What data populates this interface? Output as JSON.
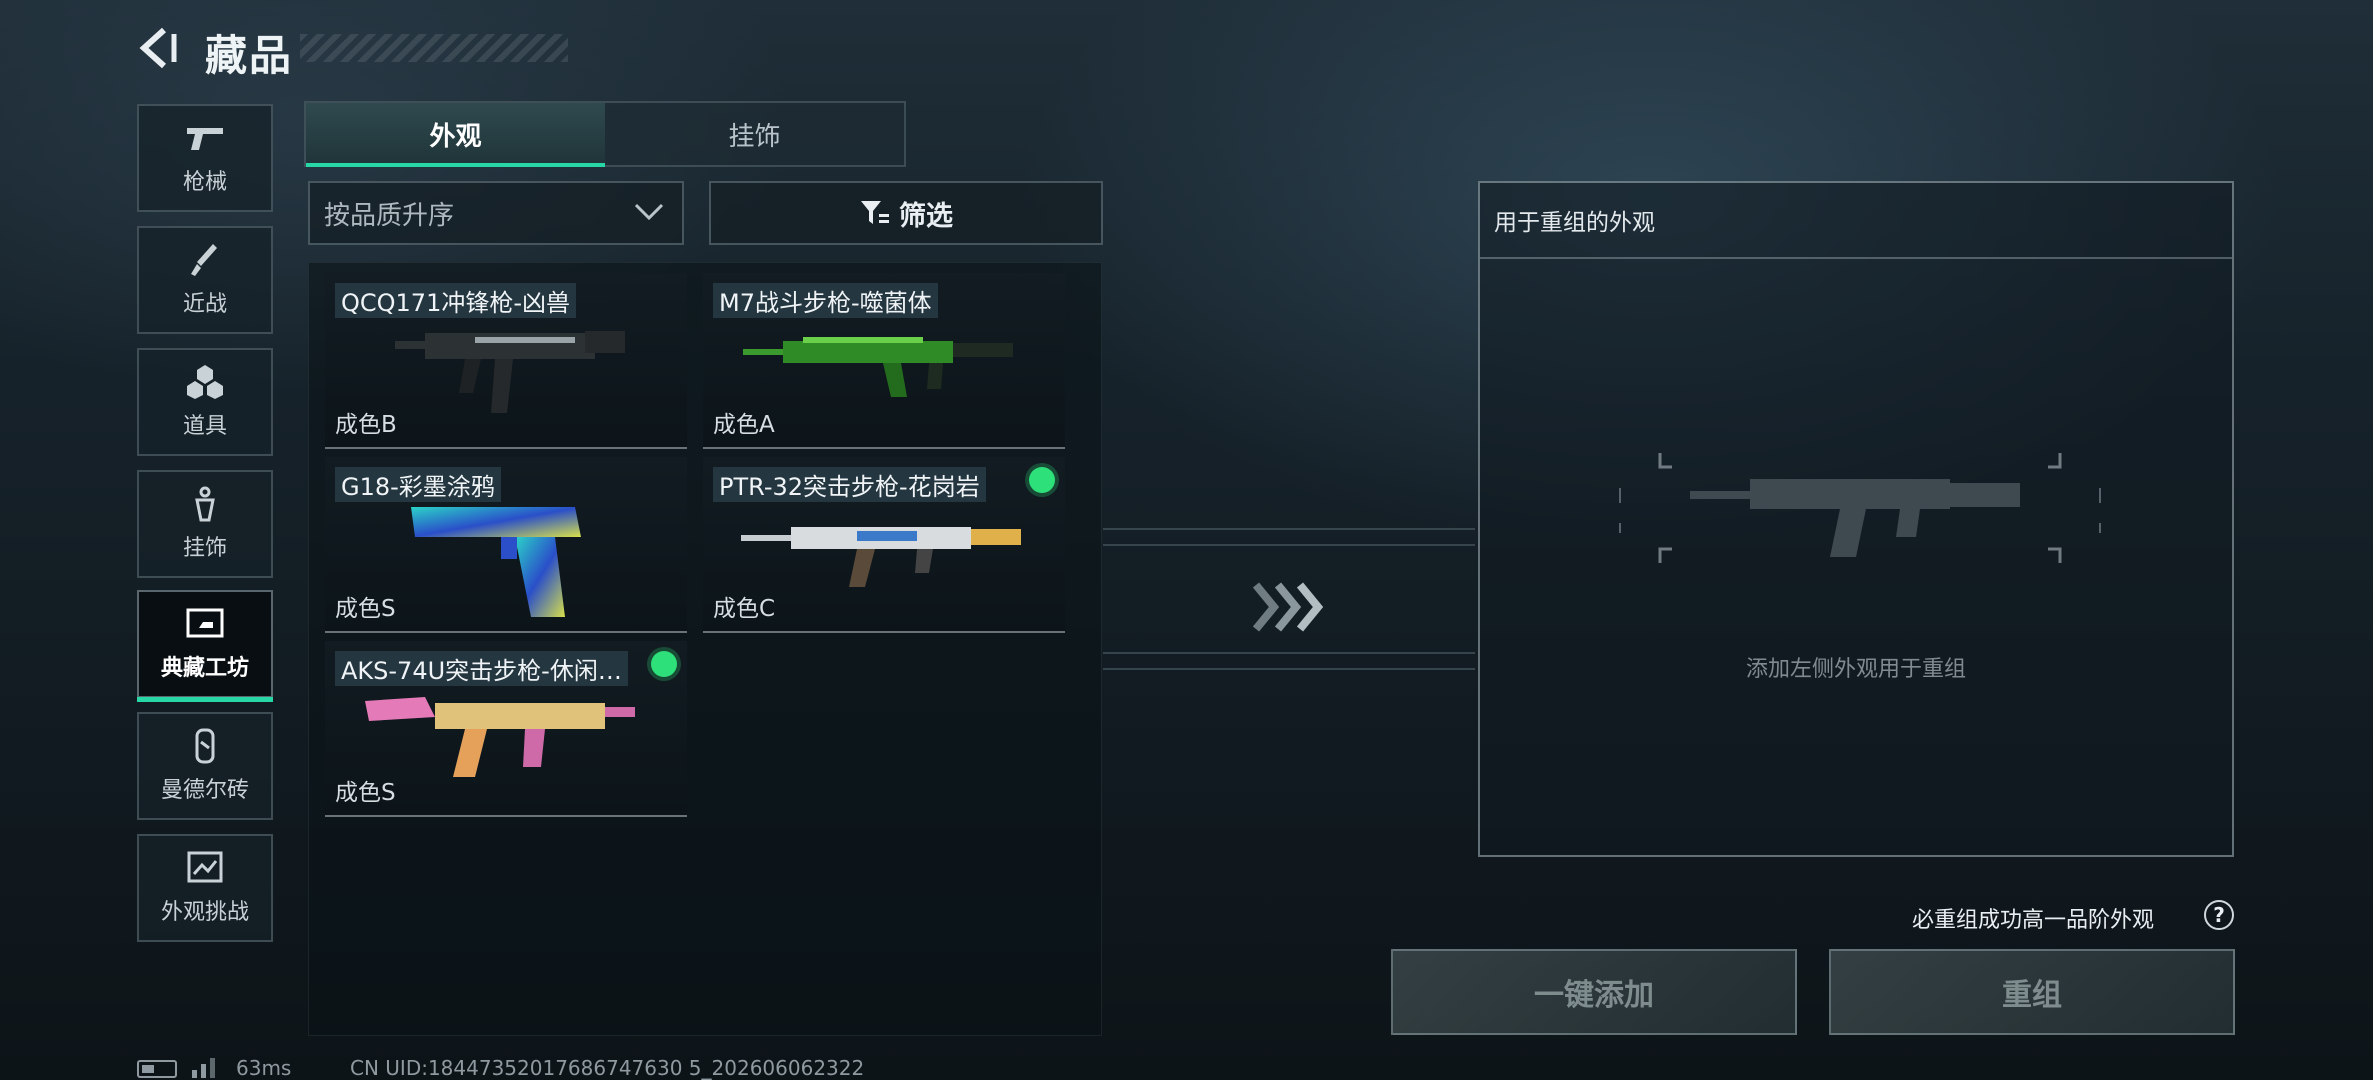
{
  "header": {
    "title": "藏品",
    "back_icon": "back-arrow-icon"
  },
  "nav": {
    "items": [
      {
        "label": "枪械",
        "icon": "pistol-icon"
      },
      {
        "label": "近战",
        "icon": "knife-icon"
      },
      {
        "label": "道具",
        "icon": "hexagon-cluster-icon"
      },
      {
        "label": "挂饰",
        "icon": "charm-icon"
      },
      {
        "label": "典藏工坊",
        "icon": "workshop-icon",
        "active": true
      },
      {
        "label": "曼德尔砖",
        "icon": "brick-icon"
      },
      {
        "label": "外观挑战",
        "icon": "challenge-icon"
      }
    ]
  },
  "tabs": [
    {
      "label": "外观",
      "active": true
    },
    {
      "label": "挂饰",
      "active": false
    }
  ],
  "sort": {
    "selected": "按品质升序"
  },
  "filter": {
    "label": "筛选"
  },
  "skins": [
    {
      "name": "QCQ171冲锋枪-凶兽",
      "grade": "成色B",
      "marked": false
    },
    {
      "name": "M7战斗步枪-噬菌体",
      "grade": "成色A",
      "marked": false
    },
    {
      "name": "G18-彩墨涂鸦",
      "grade": "成色S",
      "marked": false
    },
    {
      "name": "PTR-32突击步枪-花岗岩",
      "grade": "成色C",
      "marked": true
    },
    {
      "name": "AKS-74U突击步枪-休闲…",
      "grade": "成色S",
      "marked": true
    }
  ],
  "recombine": {
    "header": "用于重组的外观",
    "empty_hint": "添加左侧外观用于重组",
    "help_text": "必重组成功高一品阶外观",
    "help_icon": "?",
    "add_all_button": "一键添加",
    "recombine_button": "重组"
  },
  "status": {
    "ping": "63ms",
    "uid": "CN UID:18447352017686747630 5_202606062322"
  },
  "colors": {
    "accent": "#27d7a6",
    "marker": "#2ee07a"
  }
}
